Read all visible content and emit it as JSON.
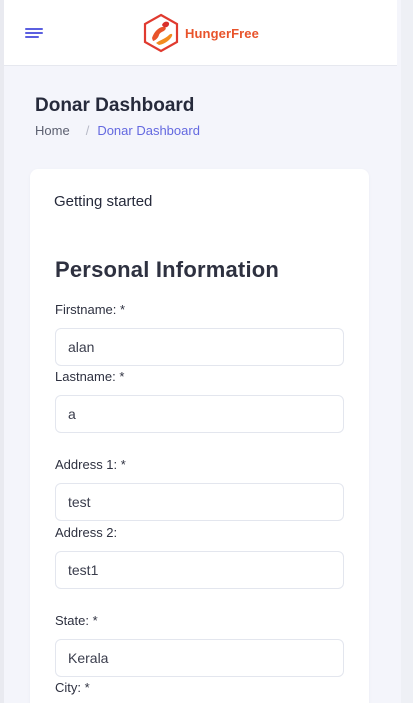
{
  "header": {
    "brand_name": "HungerFree",
    "menu_icon": "hamburger-menu-icon",
    "logo_icon": "helping-hands-logo",
    "brand_color": "#e8532b",
    "accent_color": "#5b5fe0"
  },
  "page": {
    "title": "Donar Dashboard",
    "breadcrumb": {
      "home": "Home",
      "separator": "/",
      "current": "Donar Dashboard"
    }
  },
  "card": {
    "header": "Getting started",
    "section_title": "Personal Information",
    "fields": {
      "firstname": {
        "label": "Firstname: *",
        "value": "alan"
      },
      "lastname": {
        "label": "Lastname: *",
        "value": "a"
      },
      "address1": {
        "label": "Address 1: *",
        "value": "test"
      },
      "address2": {
        "label": "Address 2:",
        "value": "test1"
      },
      "state": {
        "label": "State: *",
        "value": "Kerala"
      },
      "city": {
        "label": "City: *"
      }
    }
  }
}
